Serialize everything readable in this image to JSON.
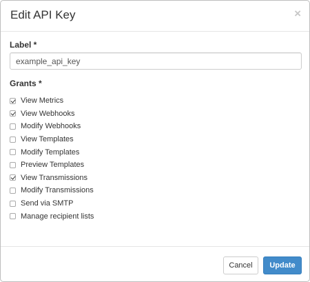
{
  "modal": {
    "title": "Edit API Key",
    "close_symbol": "×"
  },
  "form": {
    "label_title": "Label *",
    "label_value": "example_api_key",
    "grants_title": "Grants *",
    "grants": [
      {
        "label": "View Metrics",
        "checked": true
      },
      {
        "label": "View Webhooks",
        "checked": true
      },
      {
        "label": "Modify Webhooks",
        "checked": false
      },
      {
        "label": "View Templates",
        "checked": false
      },
      {
        "label": "Modify Templates",
        "checked": false
      },
      {
        "label": "Preview Templates",
        "checked": false
      },
      {
        "label": "View Transmissions",
        "checked": true
      },
      {
        "label": "Modify Transmissions",
        "checked": false
      },
      {
        "label": "Send via SMTP",
        "checked": false
      },
      {
        "label": "Manage recipient lists",
        "checked": false
      }
    ]
  },
  "footer": {
    "cancel_label": "Cancel",
    "update_label": "Update"
  },
  "colors": {
    "primary": "#428bca",
    "border": "#cccccc"
  },
  "icons": {
    "close": "close-icon",
    "checkbox": "checkbox-icon"
  }
}
